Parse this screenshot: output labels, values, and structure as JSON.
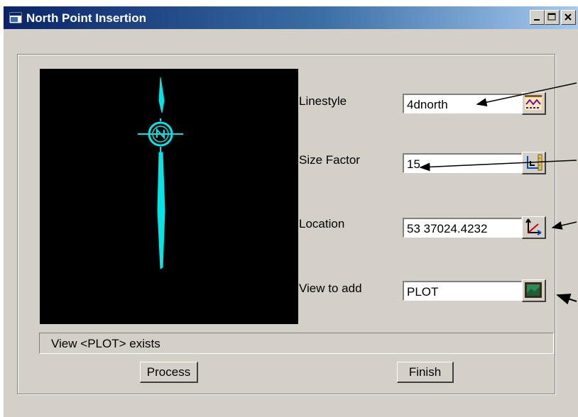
{
  "window": {
    "title": "North Point Insertion",
    "controls": [
      "minimize-icon",
      "maximize-icon",
      "close-icon"
    ]
  },
  "form": {
    "linestyle": {
      "label": "Linestyle",
      "value": "4dnorth",
      "picker_icon": "linestyle-picker-icon"
    },
    "size_factor": {
      "label": "Size Factor",
      "value": "15",
      "picker_icon": "size-factor-picker-icon"
    },
    "location": {
      "label": "Location",
      "value": "53 37024.4232",
      "picker_icon": "location-pick-icon"
    },
    "view": {
      "label": "View to add",
      "value": "PLOT",
      "picker_icon": "view-picker-icon"
    }
  },
  "status": {
    "message": "View <PLOT> exists"
  },
  "buttons": {
    "process": "Process",
    "finish": "Finish"
  },
  "preview": {
    "background": "#000000",
    "symbol_color": "#00e5e5",
    "symbol": "north-arrow-icon"
  }
}
